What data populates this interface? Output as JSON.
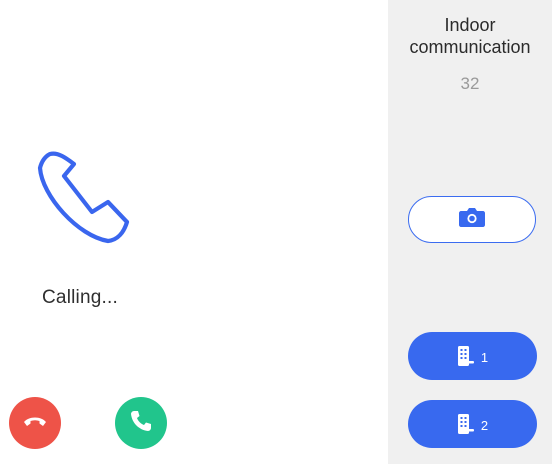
{
  "call": {
    "status_text": "Calling...",
    "handset_icon": "phone-handset-icon",
    "hangup_icon": "phone-hangup-icon",
    "answer_icon": "phone-answer-icon"
  },
  "panel": {
    "title": "Indoor communication",
    "number": "32",
    "snapshot_icon": "camera-icon",
    "unlock_buttons": [
      {
        "label": "1",
        "icon": "door-lock-icon"
      },
      {
        "label": "2",
        "icon": "door-lock-icon"
      }
    ]
  },
  "colors": {
    "accent": "#3869ef",
    "hangup": "#ee5348",
    "answer": "#21c58c",
    "panel_bg": "#f0f0f0"
  }
}
